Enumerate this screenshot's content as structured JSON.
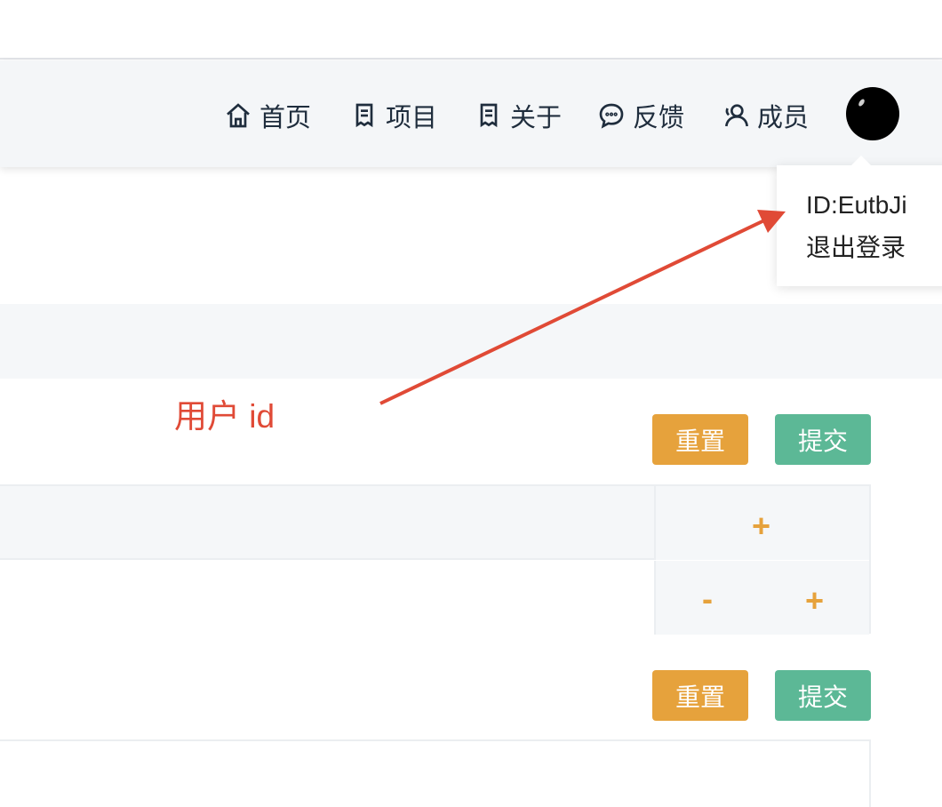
{
  "nav": {
    "items": [
      {
        "label": "首页",
        "icon": "home-icon"
      },
      {
        "label": "项目",
        "icon": "document-icon"
      },
      {
        "label": "关于",
        "icon": "document-icon"
      },
      {
        "label": "反馈",
        "icon": "chat-icon"
      },
      {
        "label": "成员",
        "icon": "user-icon"
      }
    ]
  },
  "user_menu": {
    "id_text": "ID:EutbJi",
    "logout_label": "退出登录"
  },
  "annotation": {
    "text": "用户 id",
    "color": "#e04a36"
  },
  "form_1": {
    "reset_label": "重置",
    "submit_label": "提交"
  },
  "table": {
    "row_1_ops": [
      "+"
    ],
    "row_2_ops": [
      "-",
      "+"
    ]
  },
  "form_2": {
    "reset_label": "重置",
    "submit_label": "提交"
  },
  "colors": {
    "reset": "#e6a23c",
    "submit": "#5cb896",
    "nav_text": "#1f2d3d"
  }
}
